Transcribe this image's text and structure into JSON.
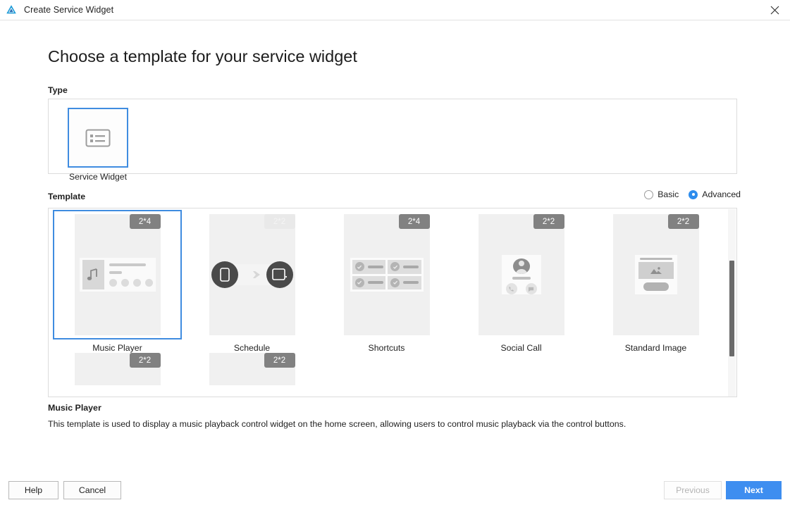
{
  "titlebar": {
    "title": "Create Service Widget",
    "logo_icon": "deveco-logo-icon",
    "close_icon": "close-icon"
  },
  "page": {
    "heading": "Choose a template for your service widget"
  },
  "type_section": {
    "label": "Type",
    "cards": [
      {
        "label": "Service Widget",
        "icon": "service-widget-list-icon",
        "selected": true
      }
    ]
  },
  "template_section": {
    "label": "Template",
    "mode_options": [
      {
        "label": "Basic",
        "selected": false
      },
      {
        "label": "Advanced",
        "selected": true
      }
    ],
    "templates": [
      {
        "label": "Music Player",
        "size": "2*4",
        "selected": true,
        "badge_style": "dark"
      },
      {
        "label": "Schedule",
        "size": "2*2",
        "selected": false,
        "badge_style": "light"
      },
      {
        "label": "Shortcuts",
        "size": "2*4",
        "selected": false,
        "badge_style": "dark"
      },
      {
        "label": "Social Call",
        "size": "2*2",
        "selected": false,
        "badge_style": "dark"
      },
      {
        "label": "Standard Image",
        "size": "2*2",
        "selected": false,
        "badge_style": "dark"
      }
    ],
    "templates_row2_partial": [
      {
        "size": "2*2"
      },
      {
        "size": "2*2"
      }
    ]
  },
  "description": {
    "title": "Music Player",
    "text": "This template is used to display a music playback control widget on the home screen, allowing users to control music playback via the control buttons."
  },
  "footer": {
    "help_label": "Help",
    "cancel_label": "Cancel",
    "previous_label": "Previous",
    "next_label": "Next"
  },
  "colors": {
    "accent": "#3e8ef0",
    "selection_border": "#3f8ce0",
    "badge_dark": "#818181",
    "badge_light": "#e9e9e9"
  }
}
